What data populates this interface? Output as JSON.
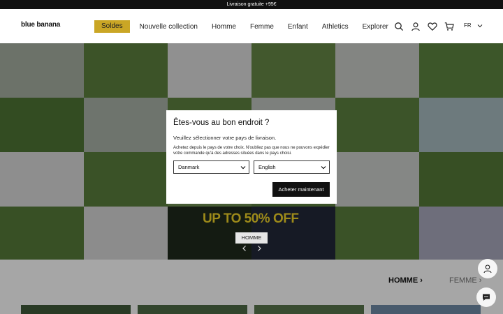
{
  "topbar": {
    "text": "Livraison gratuite +95€"
  },
  "header": {
    "logo": "blue banana",
    "nav": [
      "Soldes",
      "Nouvelle collection",
      "Homme",
      "Femme",
      "Enfant",
      "Athletics",
      "Explorer"
    ],
    "language": "FR",
    "icons": [
      "search-icon",
      "account-icon",
      "heart-icon",
      "cart-icon"
    ],
    "accent_color": "#caa625"
  },
  "hero": {
    "promo": "UP TO 50% OFF",
    "category_button": "HOMME",
    "promo_color": "#9d8a1a"
  },
  "section": {
    "title_active": "HOMME",
    "title_next": "FEMME"
  },
  "modal": {
    "title": "Êtes-vous au bon endroit ?",
    "subtitle": "Veuillez sélectionner votre pays de livraison.",
    "description": "Achetez depuis le pays de votre choix. N'oubliez pas que nous ne pouvons expédier votre commande qu'à des adresses situées dans le pays choisi.",
    "country_value": "Danmark",
    "language_value": "English",
    "button": "Acheter maintenant"
  }
}
